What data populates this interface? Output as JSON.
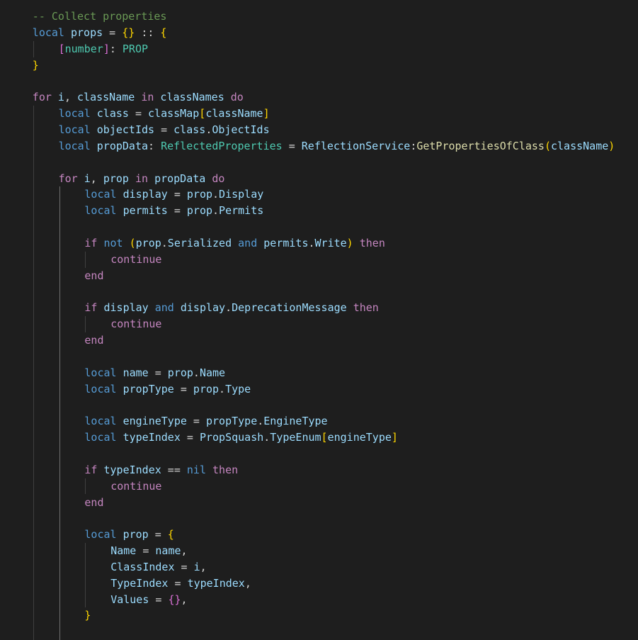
{
  "editor": {
    "language": "Luau",
    "theme_colors": {
      "background": "#1e1e1e",
      "keyword": "#569cd6",
      "control": "#c586c0",
      "variable": "#9cdcfe",
      "function": "#dcdcaa",
      "type": "#4ec9b0",
      "comment": "#6a9955",
      "bracket_1": "#ffd700",
      "bracket_2": "#da70d6",
      "bracket_3": "#179fff"
    },
    "lines": [
      {
        "indent": 1,
        "tokens": [
          {
            "t": "-- Collect properties",
            "c": "cm"
          }
        ]
      },
      {
        "indent": 1,
        "tokens": [
          {
            "t": "local",
            "c": "kw"
          },
          {
            "t": " ",
            "c": "op"
          },
          {
            "t": "props",
            "c": "var"
          },
          {
            "t": " = ",
            "c": "op"
          },
          {
            "t": "{}",
            "c": "br1"
          },
          {
            "t": " :: ",
            "c": "op"
          },
          {
            "t": "{",
            "c": "br1"
          }
        ]
      },
      {
        "indent": 2,
        "tokens": [
          {
            "t": "[",
            "c": "br2"
          },
          {
            "t": "number",
            "c": "ty"
          },
          {
            "t": "]",
            "c": "br2"
          },
          {
            "t": ": ",
            "c": "op"
          },
          {
            "t": "PROP",
            "c": "ty"
          }
        ]
      },
      {
        "indent": 1,
        "tokens": [
          {
            "t": "}",
            "c": "br1"
          }
        ]
      },
      {
        "indent": 1,
        "tokens": []
      },
      {
        "indent": 1,
        "tokens": [
          {
            "t": "for",
            "c": "ctl"
          },
          {
            "t": " ",
            "c": "op"
          },
          {
            "t": "i",
            "c": "var"
          },
          {
            "t": ", ",
            "c": "op"
          },
          {
            "t": "className",
            "c": "var"
          },
          {
            "t": " ",
            "c": "op"
          },
          {
            "t": "in",
            "c": "ctl"
          },
          {
            "t": " ",
            "c": "op"
          },
          {
            "t": "classNames",
            "c": "var"
          },
          {
            "t": " ",
            "c": "op"
          },
          {
            "t": "do",
            "c": "ctl"
          }
        ]
      },
      {
        "indent": 2,
        "tokens": [
          {
            "t": "local",
            "c": "kw"
          },
          {
            "t": " ",
            "c": "op"
          },
          {
            "t": "class",
            "c": "var"
          },
          {
            "t": " = ",
            "c": "op"
          },
          {
            "t": "classMap",
            "c": "var"
          },
          {
            "t": "[",
            "c": "br1"
          },
          {
            "t": "className",
            "c": "var"
          },
          {
            "t": "]",
            "c": "br1"
          }
        ]
      },
      {
        "indent": 2,
        "tokens": [
          {
            "t": "local",
            "c": "kw"
          },
          {
            "t": " ",
            "c": "op"
          },
          {
            "t": "objectIds",
            "c": "var"
          },
          {
            "t": " = ",
            "c": "op"
          },
          {
            "t": "class",
            "c": "var"
          },
          {
            "t": ".",
            "c": "op"
          },
          {
            "t": "ObjectIds",
            "c": "var"
          }
        ]
      },
      {
        "indent": 2,
        "tokens": [
          {
            "t": "local",
            "c": "kw"
          },
          {
            "t": " ",
            "c": "op"
          },
          {
            "t": "propData",
            "c": "var"
          },
          {
            "t": ": ",
            "c": "op"
          },
          {
            "t": "ReflectedProperties",
            "c": "ty"
          },
          {
            "t": " = ",
            "c": "op"
          },
          {
            "t": "ReflectionService",
            "c": "var"
          },
          {
            "t": ":",
            "c": "op"
          },
          {
            "t": "GetPropertiesOfClass",
            "c": "fn"
          },
          {
            "t": "(",
            "c": "br1"
          },
          {
            "t": "className",
            "c": "var"
          },
          {
            "t": ")",
            "c": "br1"
          }
        ]
      },
      {
        "indent": 2,
        "tokens": []
      },
      {
        "indent": 2,
        "tokens": [
          {
            "t": "for",
            "c": "ctl"
          },
          {
            "t": " ",
            "c": "op"
          },
          {
            "t": "i",
            "c": "var"
          },
          {
            "t": ", ",
            "c": "op"
          },
          {
            "t": "prop",
            "c": "var"
          },
          {
            "t": " ",
            "c": "op"
          },
          {
            "t": "in",
            "c": "ctl"
          },
          {
            "t": " ",
            "c": "op"
          },
          {
            "t": "propData",
            "c": "var"
          },
          {
            "t": " ",
            "c": "op"
          },
          {
            "t": "do",
            "c": "ctl"
          }
        ]
      },
      {
        "indent": 3,
        "tokens": [
          {
            "t": "local",
            "c": "kw"
          },
          {
            "t": " ",
            "c": "op"
          },
          {
            "t": "display",
            "c": "var"
          },
          {
            "t": " = ",
            "c": "op"
          },
          {
            "t": "prop",
            "c": "var"
          },
          {
            "t": ".",
            "c": "op"
          },
          {
            "t": "Display",
            "c": "var"
          }
        ]
      },
      {
        "indent": 3,
        "tokens": [
          {
            "t": "local",
            "c": "kw"
          },
          {
            "t": " ",
            "c": "op"
          },
          {
            "t": "permits",
            "c": "var"
          },
          {
            "t": " = ",
            "c": "op"
          },
          {
            "t": "prop",
            "c": "var"
          },
          {
            "t": ".",
            "c": "op"
          },
          {
            "t": "Permits",
            "c": "var"
          }
        ]
      },
      {
        "indent": 3,
        "tokens": []
      },
      {
        "indent": 3,
        "tokens": [
          {
            "t": "if",
            "c": "ctl"
          },
          {
            "t": " ",
            "c": "op"
          },
          {
            "t": "not",
            "c": "kw"
          },
          {
            "t": " ",
            "c": "op"
          },
          {
            "t": "(",
            "c": "br1"
          },
          {
            "t": "prop",
            "c": "var"
          },
          {
            "t": ".",
            "c": "op"
          },
          {
            "t": "Serialized",
            "c": "var"
          },
          {
            "t": " ",
            "c": "op"
          },
          {
            "t": "and",
            "c": "kw"
          },
          {
            "t": " ",
            "c": "op"
          },
          {
            "t": "permits",
            "c": "var"
          },
          {
            "t": ".",
            "c": "op"
          },
          {
            "t": "Write",
            "c": "var"
          },
          {
            "t": ")",
            "c": "br1"
          },
          {
            "t": " ",
            "c": "op"
          },
          {
            "t": "then",
            "c": "ctl"
          }
        ]
      },
      {
        "indent": 4,
        "tokens": [
          {
            "t": "continue",
            "c": "ctl"
          }
        ]
      },
      {
        "indent": 3,
        "tokens": [
          {
            "t": "end",
            "c": "ctl"
          }
        ]
      },
      {
        "indent": 3,
        "tokens": []
      },
      {
        "indent": 3,
        "tokens": [
          {
            "t": "if",
            "c": "ctl"
          },
          {
            "t": " ",
            "c": "op"
          },
          {
            "t": "display",
            "c": "var"
          },
          {
            "t": " ",
            "c": "op"
          },
          {
            "t": "and",
            "c": "kw"
          },
          {
            "t": " ",
            "c": "op"
          },
          {
            "t": "display",
            "c": "var"
          },
          {
            "t": ".",
            "c": "op"
          },
          {
            "t": "DeprecationMessage",
            "c": "var"
          },
          {
            "t": " ",
            "c": "op"
          },
          {
            "t": "then",
            "c": "ctl"
          }
        ]
      },
      {
        "indent": 4,
        "tokens": [
          {
            "t": "continue",
            "c": "ctl"
          }
        ]
      },
      {
        "indent": 3,
        "tokens": [
          {
            "t": "end",
            "c": "ctl"
          }
        ]
      },
      {
        "indent": 3,
        "tokens": []
      },
      {
        "indent": 3,
        "tokens": [
          {
            "t": "local",
            "c": "kw"
          },
          {
            "t": " ",
            "c": "op"
          },
          {
            "t": "name",
            "c": "var"
          },
          {
            "t": " = ",
            "c": "op"
          },
          {
            "t": "prop",
            "c": "var"
          },
          {
            "t": ".",
            "c": "op"
          },
          {
            "t": "Name",
            "c": "var"
          }
        ]
      },
      {
        "indent": 3,
        "tokens": [
          {
            "t": "local",
            "c": "kw"
          },
          {
            "t": " ",
            "c": "op"
          },
          {
            "t": "propType",
            "c": "var"
          },
          {
            "t": " = ",
            "c": "op"
          },
          {
            "t": "prop",
            "c": "var"
          },
          {
            "t": ".",
            "c": "op"
          },
          {
            "t": "Type",
            "c": "var"
          }
        ]
      },
      {
        "indent": 3,
        "tokens": []
      },
      {
        "indent": 3,
        "tokens": [
          {
            "t": "local",
            "c": "kw"
          },
          {
            "t": " ",
            "c": "op"
          },
          {
            "t": "engineType",
            "c": "var"
          },
          {
            "t": " = ",
            "c": "op"
          },
          {
            "t": "propType",
            "c": "var"
          },
          {
            "t": ".",
            "c": "op"
          },
          {
            "t": "EngineType",
            "c": "var"
          }
        ]
      },
      {
        "indent": 3,
        "tokens": [
          {
            "t": "local",
            "c": "kw"
          },
          {
            "t": " ",
            "c": "op"
          },
          {
            "t": "typeIndex",
            "c": "var"
          },
          {
            "t": " = ",
            "c": "op"
          },
          {
            "t": "PropSquash",
            "c": "var"
          },
          {
            "t": ".",
            "c": "op"
          },
          {
            "t": "TypeEnum",
            "c": "var"
          },
          {
            "t": "[",
            "c": "br1"
          },
          {
            "t": "engineType",
            "c": "var"
          },
          {
            "t": "]",
            "c": "br1"
          }
        ]
      },
      {
        "indent": 3,
        "tokens": []
      },
      {
        "indent": 3,
        "tokens": [
          {
            "t": "if",
            "c": "ctl"
          },
          {
            "t": " ",
            "c": "op"
          },
          {
            "t": "typeIndex",
            "c": "var"
          },
          {
            "t": " == ",
            "c": "op"
          },
          {
            "t": "nil",
            "c": "kw"
          },
          {
            "t": " ",
            "c": "op"
          },
          {
            "t": "then",
            "c": "ctl"
          }
        ]
      },
      {
        "indent": 4,
        "tokens": [
          {
            "t": "continue",
            "c": "ctl"
          }
        ]
      },
      {
        "indent": 3,
        "tokens": [
          {
            "t": "end",
            "c": "ctl"
          }
        ]
      },
      {
        "indent": 3,
        "tokens": []
      },
      {
        "indent": 3,
        "tokens": [
          {
            "t": "local",
            "c": "kw"
          },
          {
            "t": " ",
            "c": "op"
          },
          {
            "t": "prop",
            "c": "var"
          },
          {
            "t": " = ",
            "c": "op"
          },
          {
            "t": "{",
            "c": "br1"
          }
        ]
      },
      {
        "indent": 4,
        "tokens": [
          {
            "t": "Name",
            "c": "var"
          },
          {
            "t": " = ",
            "c": "op"
          },
          {
            "t": "name",
            "c": "var"
          },
          {
            "t": ",",
            "c": "op"
          }
        ]
      },
      {
        "indent": 4,
        "tokens": [
          {
            "t": "ClassIndex",
            "c": "var"
          },
          {
            "t": " = ",
            "c": "op"
          },
          {
            "t": "i",
            "c": "var"
          },
          {
            "t": ",",
            "c": "op"
          }
        ]
      },
      {
        "indent": 4,
        "tokens": [
          {
            "t": "TypeIndex",
            "c": "var"
          },
          {
            "t": " = ",
            "c": "op"
          },
          {
            "t": "typeIndex",
            "c": "var"
          },
          {
            "t": ",",
            "c": "op"
          }
        ]
      },
      {
        "indent": 4,
        "tokens": [
          {
            "t": "Values",
            "c": "var"
          },
          {
            "t": " = ",
            "c": "op"
          },
          {
            "t": "{}",
            "c": "br2"
          },
          {
            "t": ",",
            "c": "op"
          }
        ]
      },
      {
        "indent": 3,
        "tokens": [
          {
            "t": "}",
            "c": "br1"
          }
        ]
      }
    ]
  }
}
